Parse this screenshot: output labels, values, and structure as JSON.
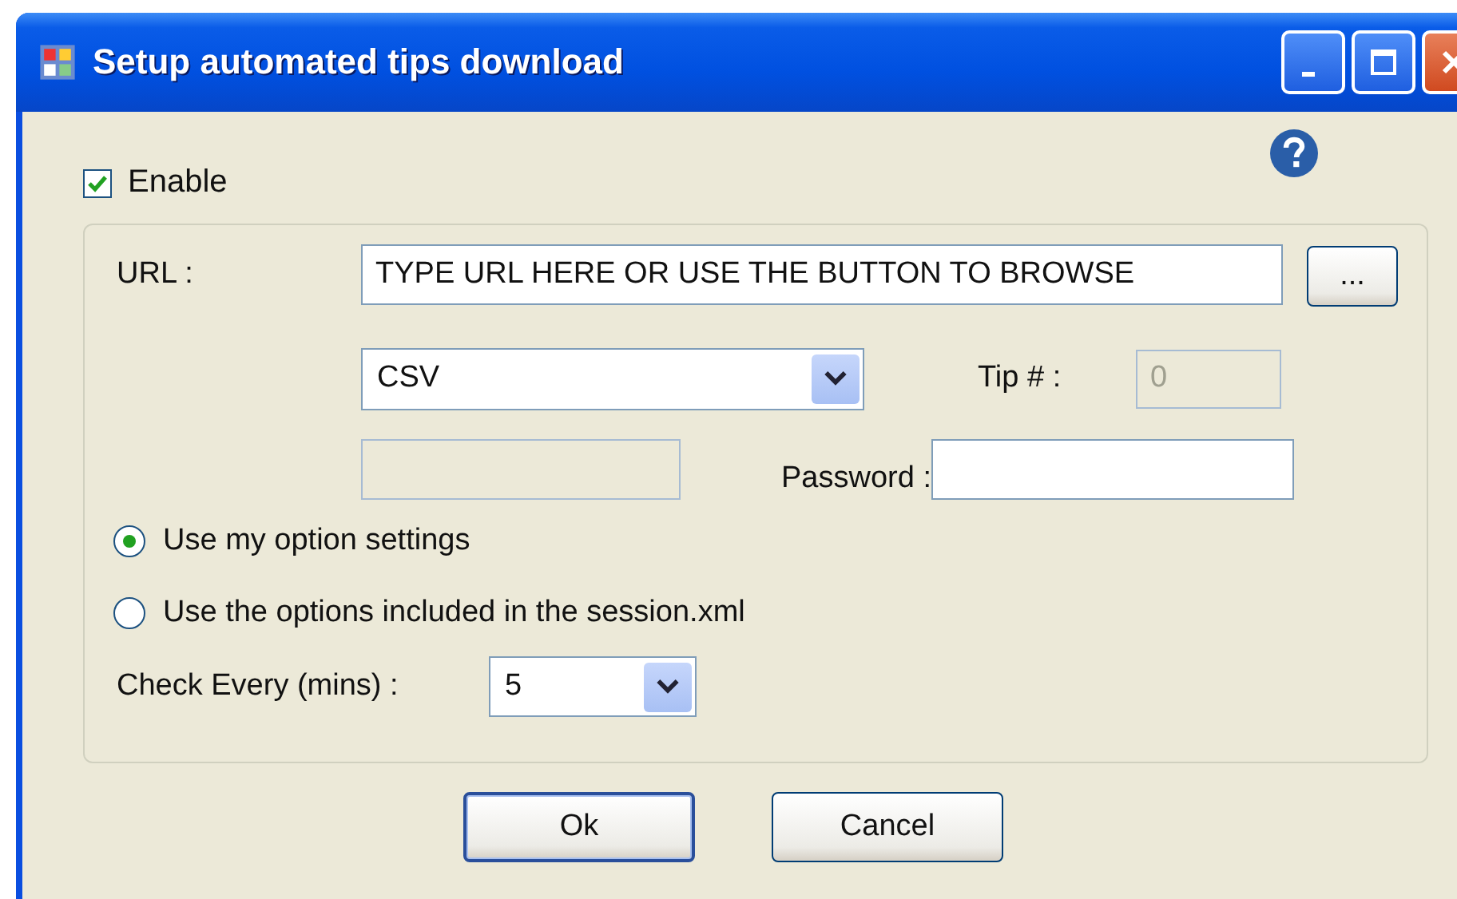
{
  "window": {
    "title": "Setup automated tips download"
  },
  "enable": {
    "label": "Enable",
    "checked": true
  },
  "url": {
    "label": "URL :",
    "value": "TYPE URL HERE OR USE THE BUTTON TO BROWSE",
    "browse_button": "..."
  },
  "format": {
    "value": "CSV"
  },
  "tip": {
    "label": "Tip # :",
    "value": "0",
    "disabled": true
  },
  "user_field": {
    "disabled": true
  },
  "password": {
    "label": "Password :",
    "disabled": false
  },
  "options": [
    {
      "label": "Use my option settings",
      "selected": true
    },
    {
      "label": "Use the options included in the session.xml",
      "selected": false
    }
  ],
  "check_every": {
    "label": "Check Every (mins) :",
    "value": "5"
  },
  "buttons": [
    {
      "label": "Ok",
      "default": true
    },
    {
      "label": "Cancel",
      "default": false
    }
  ]
}
